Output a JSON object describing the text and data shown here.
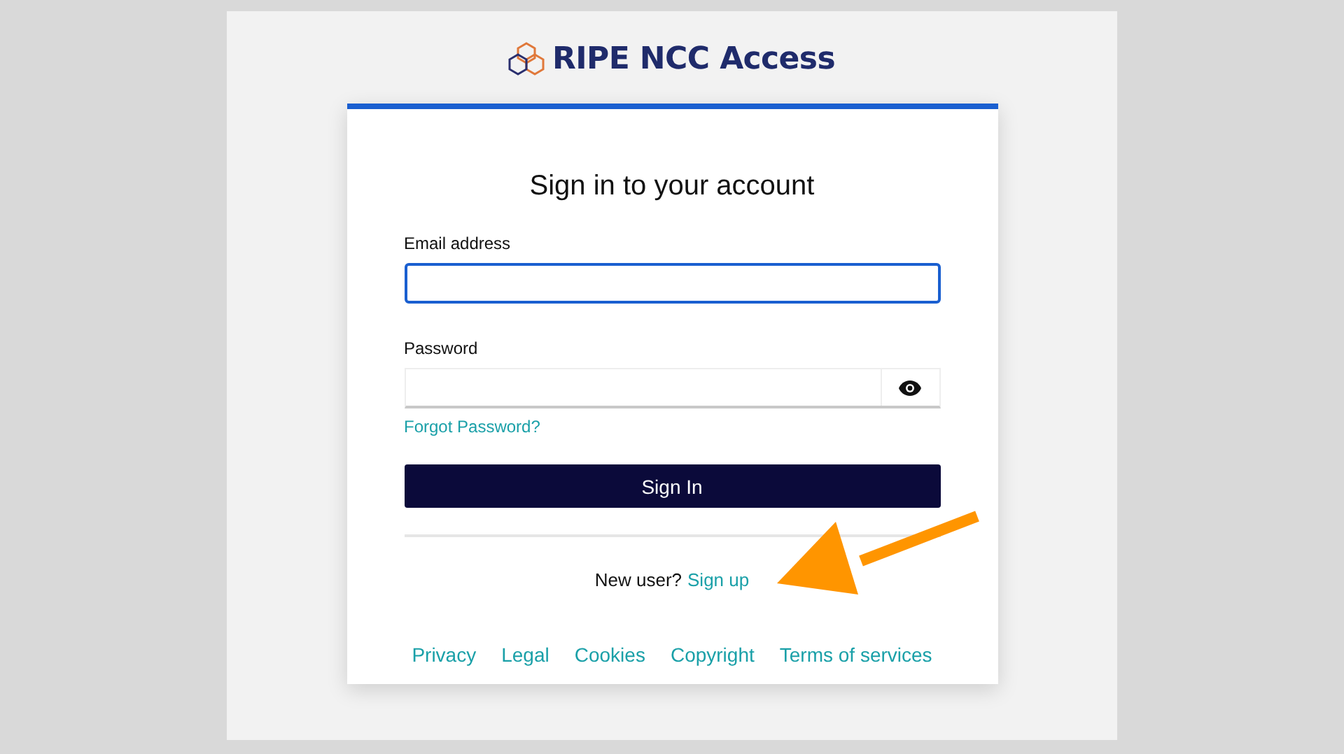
{
  "brand": {
    "name": "RIPE NCC Access"
  },
  "card": {
    "title": "Sign in to your account",
    "fields": [
      {
        "kind": "text",
        "label": "Email address",
        "focused": true
      },
      {
        "kind": "password",
        "label": "Password",
        "focused": false
      }
    ],
    "forgot_link": "Forgot Password?",
    "submit": "Sign In",
    "signup_prompt": "New user?",
    "signup_link": "Sign up",
    "footer_links": [
      "Privacy",
      "Legal",
      "Cookies",
      "Copyright",
      "Terms of services"
    ]
  },
  "overlay": {
    "kind": "arrow"
  }
}
